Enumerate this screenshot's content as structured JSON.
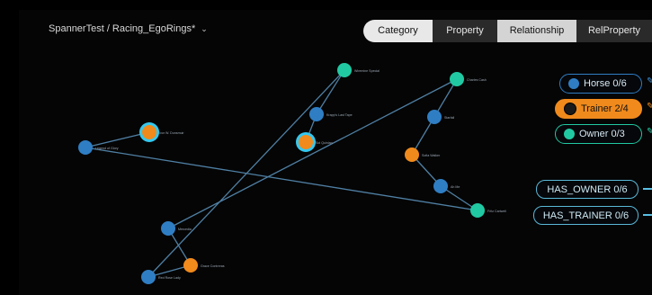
{
  "header": {
    "breadcrumb": "SpannerTest / Racing_EgoRings*",
    "tabs": [
      {
        "label": "Category",
        "active": true
      },
      {
        "label": "Property",
        "active": false
      },
      {
        "label": "Relationship",
        "active": false
      },
      {
        "label": "RelProperty",
        "active": false
      }
    ]
  },
  "colors": {
    "horse": "#2f7ec4",
    "trainer": "#f08a1c",
    "owner": "#21c9a2",
    "edge": "#4f7fa3",
    "selected_ring": "#35c8f0"
  },
  "categories": [
    {
      "label": "Horse 0/6",
      "type": "horse"
    },
    {
      "label": "Trainer 2/4",
      "type": "trainer"
    },
    {
      "label": "Owner 0/3",
      "type": "owner"
    }
  ],
  "relationships": [
    {
      "label": "HAS_OWNER 0/6"
    },
    {
      "label": "HAS_TRAINER 0/6"
    }
  ],
  "graph": {
    "nodes": [
      {
        "id": "n1",
        "type": "owner",
        "selected": false,
        "label": "Wiremine Special"
      },
      {
        "id": "n2",
        "type": "horse",
        "selected": false,
        "label": "Krapp's Last Tape"
      },
      {
        "id": "n3",
        "type": "trainer",
        "selected": true,
        "label": "Sol Quinlan"
      },
      {
        "id": "n4",
        "type": "trainer",
        "selected": true,
        "label": "Ivor W. Dunsmuir"
      },
      {
        "id": "n5",
        "type": "horse",
        "selected": false,
        "label": "Legend of Glory"
      },
      {
        "id": "n6",
        "type": "owner",
        "selected": false,
        "label": "Charles Cash"
      },
      {
        "id": "n7",
        "type": "horse",
        "selected": false,
        "label": "Starfall"
      },
      {
        "id": "n8",
        "type": "trainer",
        "selected": false,
        "label": "Sofia Walker"
      },
      {
        "id": "n9",
        "type": "horse",
        "selected": false,
        "label": "Ah Me"
      },
      {
        "id": "n10",
        "type": "owner",
        "selected": false,
        "label": "Fritz Cartwell"
      },
      {
        "id": "n11",
        "type": "horse",
        "selected": false,
        "label": "Mercedia"
      },
      {
        "id": "n12",
        "type": "trainer",
        "selected": false,
        "label": "Grace Contreras"
      },
      {
        "id": "n13",
        "type": "horse",
        "selected": false,
        "label": "Red Rose Lady"
      }
    ],
    "edges": [
      [
        "n1",
        "n2"
      ],
      [
        "n2",
        "n3"
      ],
      [
        "n1",
        "n13"
      ],
      [
        "n4",
        "n5"
      ],
      [
        "n5",
        "n10"
      ],
      [
        "n6",
        "n7"
      ],
      [
        "n7",
        "n8"
      ],
      [
        "n8",
        "n9"
      ],
      [
        "n9",
        "n10"
      ],
      [
        "n6",
        "n11"
      ],
      [
        "n11",
        "n12"
      ],
      [
        "n12",
        "n13"
      ]
    ]
  }
}
